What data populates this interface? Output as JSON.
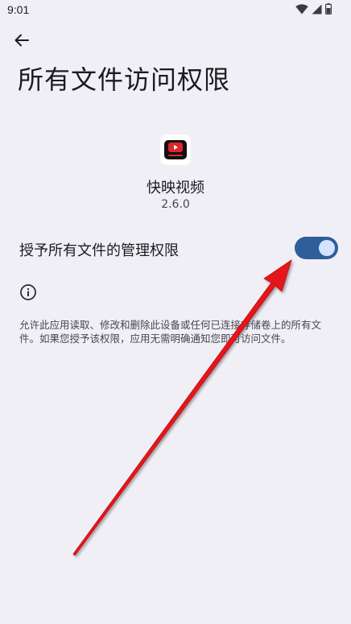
{
  "status_bar": {
    "time": "9:01",
    "icons": [
      "wifi-icon",
      "signal-icon",
      "battery-icon"
    ]
  },
  "header": {
    "back_icon": "arrow-left-icon",
    "title": "所有文件访问权限"
  },
  "app": {
    "name": "快映视频",
    "version": "2.6.0"
  },
  "permission": {
    "label": "授予所有文件的管理权限",
    "enabled": true
  },
  "info": {
    "icon": "info-icon",
    "description": "允许此应用读取、修改和删除此设备或任何已连接存储卷上的所有文件。如果您授予该权限，应用无需明确通知您即可访问文件。"
  },
  "colors": {
    "background": "#f1eff6",
    "toggle_track": "#2f5f98",
    "toggle_thumb": "#d6e3ff",
    "annotation_arrow": "#e3171c"
  }
}
